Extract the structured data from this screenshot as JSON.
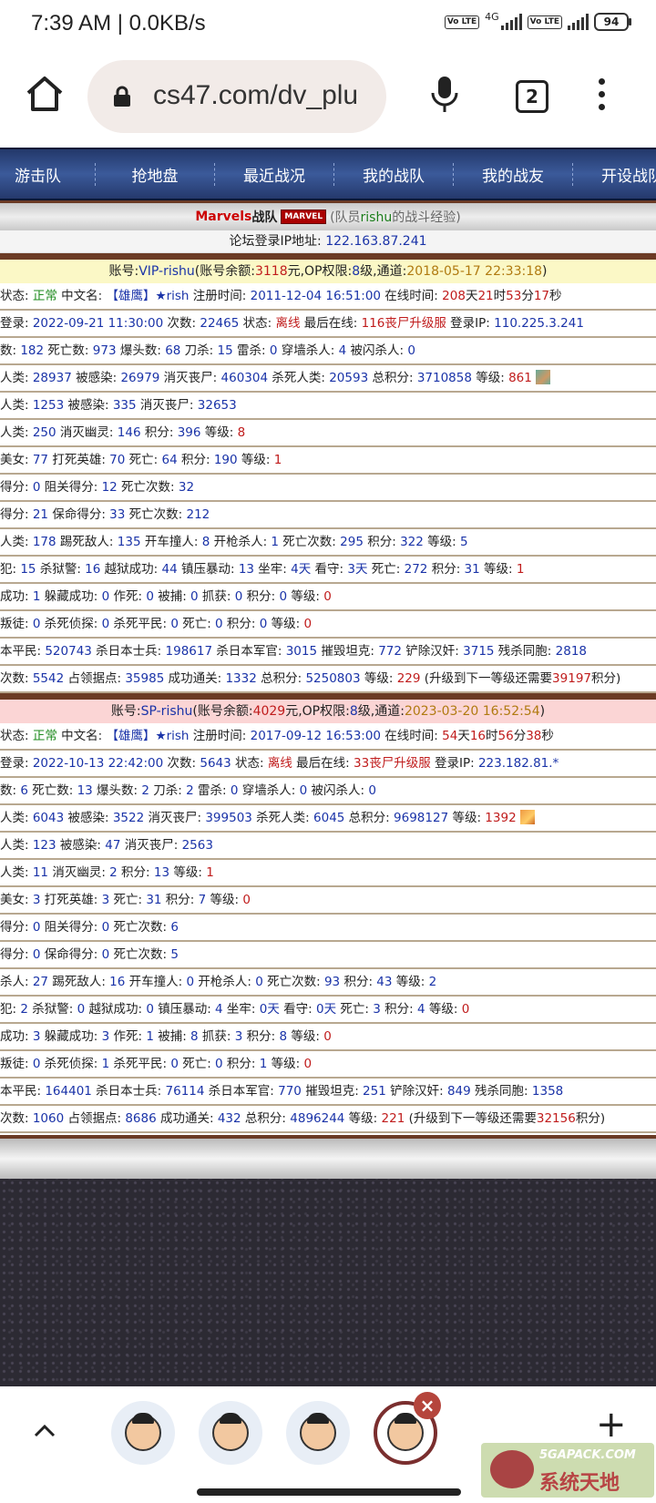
{
  "status_bar": {
    "time": "7:39 AM | 0.0KB/s",
    "network": "4G",
    "volte1": "Vo LTE",
    "volte2": "Vo LTE",
    "battery": "94"
  },
  "browser": {
    "url": "cs47.com/dv_plu",
    "tab_count": "2"
  },
  "nav": [
    "游击队",
    "抢地盘",
    "最近战况",
    "我的战队",
    "我的战友",
    "开设战队"
  ],
  "header": {
    "team_name": "Marvels",
    "team_suffix": "战队",
    "logo_text": "MARVEL",
    "sub_prefix": "(队员",
    "sub_user": "rishu",
    "sub_suffix": "的战斗经验)"
  },
  "ip_line": {
    "label": "论坛登录IP地址:",
    "ip": "122.163.87.241"
  },
  "accounts": [
    {
      "header": {
        "label": "账号:",
        "name": "VIP-rishu",
        "balance_label": "(账号余额:",
        "balance": "3118",
        "op_label": "元,OP权限:",
        "op": "8",
        "channel_label": "级,通道:",
        "channel": "2018-05-17 22:33:18",
        "end": ")"
      },
      "rows": [
        [
          "状态: ",
          {
            "t": "正常",
            "c": "g"
          },
          " 中文名: ",
          {
            "t": "【雄鹰】★rish",
            "c": "v"
          },
          " 注册时间: ",
          {
            "t": "2011-12-04 16:51:00",
            "c": "v"
          },
          " 在线时间: ",
          {
            "t": "208",
            "c": "r"
          },
          "天",
          {
            "t": "21",
            "c": "r"
          },
          "时",
          {
            "t": "53",
            "c": "r"
          },
          "分",
          {
            "t": "17",
            "c": "r"
          },
          "秒"
        ],
        [
          "登录: ",
          {
            "t": "2022-09-21 11:30:00",
            "c": "v"
          },
          " 次数: ",
          {
            "t": "22465",
            "c": "v"
          },
          " 状态: ",
          {
            "t": "离线",
            "c": "r"
          },
          " 最后在线: ",
          {
            "t": "116丧尸升级服",
            "c": "r"
          },
          " 登录IP: ",
          {
            "t": "110.225.3.241",
            "c": "v"
          }
        ],
        [
          "数: ",
          {
            "t": "182",
            "c": "v"
          },
          " 死亡数: ",
          {
            "t": "973",
            "c": "v"
          },
          " 爆头数: ",
          {
            "t": "68",
            "c": "v"
          },
          " 刀杀: ",
          {
            "t": "15",
            "c": "v"
          },
          " 雷杀: ",
          {
            "t": "0",
            "c": "v"
          },
          " 穿墙杀人: ",
          {
            "t": "4",
            "c": "v"
          },
          " 被闪杀人: ",
          {
            "t": "0",
            "c": "v"
          }
        ],
        [
          "人类: ",
          {
            "t": "28937",
            "c": "v"
          },
          " 被感染: ",
          {
            "t": "26979",
            "c": "v"
          },
          " 消灭丧尸: ",
          {
            "t": "460304",
            "c": "v"
          },
          " 杀死人类: ",
          {
            "t": "20593",
            "c": "v"
          },
          " 总积分: ",
          {
            "t": "3710858",
            "c": "v"
          },
          " 等级: ",
          {
            "t": "861",
            "c": "r"
          },
          {
            "avatar": "a"
          }
        ],
        [
          "人类: ",
          {
            "t": "1253",
            "c": "v"
          },
          " 被感染: ",
          {
            "t": "335",
            "c": "v"
          },
          " 消灭丧尸: ",
          {
            "t": "32653",
            "c": "v"
          }
        ],
        [
          "人类: ",
          {
            "t": "250",
            "c": "v"
          },
          " 消灭幽灵: ",
          {
            "t": "146",
            "c": "v"
          },
          " 积分: ",
          {
            "t": "396",
            "c": "v"
          },
          " 等级: ",
          {
            "t": "8",
            "c": "r"
          }
        ],
        [
          "美女: ",
          {
            "t": "77",
            "c": "v"
          },
          " 打死英雄: ",
          {
            "t": "70",
            "c": "v"
          },
          " 死亡: ",
          {
            "t": "64",
            "c": "v"
          },
          " 积分: ",
          {
            "t": "190",
            "c": "v"
          },
          " 等级: ",
          {
            "t": "1",
            "c": "r"
          }
        ],
        [
          "得分: ",
          {
            "t": "0",
            "c": "v"
          },
          " 阻关得分: ",
          {
            "t": "12",
            "c": "v"
          },
          " 死亡次数: ",
          {
            "t": "32",
            "c": "v"
          }
        ],
        [
          "得分: ",
          {
            "t": "21",
            "c": "v"
          },
          " 保命得分: ",
          {
            "t": "33",
            "c": "v"
          },
          " 死亡次数: ",
          {
            "t": "212",
            "c": "v"
          }
        ],
        [
          "人类: ",
          {
            "t": "178",
            "c": "v"
          },
          " 踢死敌人: ",
          {
            "t": "135",
            "c": "v"
          },
          " 开车撞人: ",
          {
            "t": "8",
            "c": "v"
          },
          " 开枪杀人: ",
          {
            "t": "1",
            "c": "v"
          },
          " 死亡次数: ",
          {
            "t": "295",
            "c": "v"
          },
          " 积分: ",
          {
            "t": "322",
            "c": "v"
          },
          " 等级: ",
          {
            "t": "5",
            "c": "v"
          }
        ],
        [
          "犯: ",
          {
            "t": "15",
            "c": "v"
          },
          " 杀狱警: ",
          {
            "t": "16",
            "c": "v"
          },
          " 越狱成功: ",
          {
            "t": "44",
            "c": "v"
          },
          " 镇压暴动: ",
          {
            "t": "13",
            "c": "v"
          },
          " 坐牢: ",
          {
            "t": "4天",
            "c": "v"
          },
          " 看守: ",
          {
            "t": "3天",
            "c": "v"
          },
          " 死亡: ",
          {
            "t": "272",
            "c": "v"
          },
          " 积分: ",
          {
            "t": "31",
            "c": "v"
          },
          " 等级: ",
          {
            "t": "1",
            "c": "r"
          }
        ],
        [
          "成功: ",
          {
            "t": "1",
            "c": "v"
          },
          " 躲藏成功: ",
          {
            "t": "0",
            "c": "v"
          },
          " 作死: ",
          {
            "t": "0",
            "c": "v"
          },
          " 被捕: ",
          {
            "t": "0",
            "c": "v"
          },
          " 抓获: ",
          {
            "t": "0",
            "c": "v"
          },
          " 积分: ",
          {
            "t": "0",
            "c": "v"
          },
          " 等级: ",
          {
            "t": "0",
            "c": "r"
          }
        ],
        [
          "叛徒: ",
          {
            "t": "0",
            "c": "v"
          },
          " 杀死侦探: ",
          {
            "t": "0",
            "c": "v"
          },
          " 杀死平民: ",
          {
            "t": "0",
            "c": "v"
          },
          " 死亡: ",
          {
            "t": "0",
            "c": "v"
          },
          " 积分: ",
          {
            "t": "0",
            "c": "v"
          },
          " 等级: ",
          {
            "t": "0",
            "c": "r"
          }
        ],
        [
          "本平民: ",
          {
            "t": "520743",
            "c": "v"
          },
          " 杀日本士兵: ",
          {
            "t": "198617",
            "c": "v"
          },
          " 杀日本军官: ",
          {
            "t": "3015",
            "c": "v"
          },
          " 摧毁坦克: ",
          {
            "t": "772",
            "c": "v"
          },
          " 铲除汉奸: ",
          {
            "t": "3715",
            "c": "v"
          },
          " 残杀同胞: ",
          {
            "t": "2818",
            "c": "v"
          }
        ],
        [
          "次数: ",
          {
            "t": "5542",
            "c": "v"
          },
          " 占领据点: ",
          {
            "t": "35985",
            "c": "v"
          },
          " 成功通关: ",
          {
            "t": "1332",
            "c": "v"
          },
          " 总积分: ",
          {
            "t": "5250803",
            "c": "v"
          },
          " 等级: ",
          {
            "t": "229",
            "c": "r"
          },
          " (升级到下一等级还需要",
          {
            "t": "39197",
            "c": "r"
          },
          "积分)"
        ]
      ]
    },
    {
      "header": {
        "label": "账号:",
        "name": "SP-rishu",
        "balance_label": "(账号余额:",
        "balance": "4029",
        "op_label": "元,OP权限:",
        "op": "8",
        "channel_label": "级,通道:",
        "channel": "2023-03-20 16:52:54",
        "end": ")"
      },
      "rows": [
        [
          "状态: ",
          {
            "t": "正常",
            "c": "g"
          },
          " 中文名: ",
          {
            "t": "【雄鹰】★rish",
            "c": "v"
          },
          " 注册时间: ",
          {
            "t": "2017-09-12 16:53:00",
            "c": "v"
          },
          " 在线时间: ",
          {
            "t": "54",
            "c": "r"
          },
          "天",
          {
            "t": "16",
            "c": "r"
          },
          "时",
          {
            "t": "56",
            "c": "r"
          },
          "分",
          {
            "t": "38",
            "c": "r"
          },
          "秒"
        ],
        [
          "登录: ",
          {
            "t": "2022-10-13 22:42:00",
            "c": "v"
          },
          " 次数: ",
          {
            "t": "5643",
            "c": "v"
          },
          " 状态: ",
          {
            "t": "离线",
            "c": "r"
          },
          " 最后在线: ",
          {
            "t": "33丧尸升级服",
            "c": "r"
          },
          " 登录IP: ",
          {
            "t": "223.182.81.*",
            "c": "v"
          }
        ],
        [
          "数: ",
          {
            "t": "6",
            "c": "v"
          },
          " 死亡数: ",
          {
            "t": "13",
            "c": "v"
          },
          " 爆头数: ",
          {
            "t": "2",
            "c": "v"
          },
          " 刀杀: ",
          {
            "t": "2",
            "c": "v"
          },
          " 雷杀: ",
          {
            "t": "0",
            "c": "v"
          },
          " 穿墙杀人: ",
          {
            "t": "0",
            "c": "v"
          },
          " 被闪杀人: ",
          {
            "t": "0",
            "c": "v"
          }
        ],
        [
          "人类: ",
          {
            "t": "6043",
            "c": "v"
          },
          " 被感染: ",
          {
            "t": "3522",
            "c": "v"
          },
          " 消灭丧尸: ",
          {
            "t": "399503",
            "c": "v"
          },
          " 杀死人类: ",
          {
            "t": "6045",
            "c": "v"
          },
          " 总积分: ",
          {
            "t": "9698127",
            "c": "v"
          },
          " 等级: ",
          {
            "t": "1392",
            "c": "r"
          },
          {
            "avatar": "b"
          }
        ],
        [
          "人类: ",
          {
            "t": "123",
            "c": "v"
          },
          " 被感染: ",
          {
            "t": "47",
            "c": "v"
          },
          " 消灭丧尸: ",
          {
            "t": "2563",
            "c": "v"
          }
        ],
        [
          "人类: ",
          {
            "t": "11",
            "c": "v"
          },
          " 消灭幽灵: ",
          {
            "t": "2",
            "c": "v"
          },
          " 积分: ",
          {
            "t": "13",
            "c": "v"
          },
          " 等级: ",
          {
            "t": "1",
            "c": "r"
          }
        ],
        [
          "美女: ",
          {
            "t": "3",
            "c": "v"
          },
          " 打死英雄: ",
          {
            "t": "3",
            "c": "v"
          },
          " 死亡: ",
          {
            "t": "31",
            "c": "v"
          },
          " 积分: ",
          {
            "t": "7",
            "c": "v"
          },
          " 等级: ",
          {
            "t": "0",
            "c": "r"
          }
        ],
        [
          "得分: ",
          {
            "t": "0",
            "c": "v"
          },
          " 阻关得分: ",
          {
            "t": "0",
            "c": "v"
          },
          " 死亡次数: ",
          {
            "t": "6",
            "c": "v"
          }
        ],
        [
          "得分: ",
          {
            "t": "0",
            "c": "v"
          },
          " 保命得分: ",
          {
            "t": "0",
            "c": "v"
          },
          " 死亡次数: ",
          {
            "t": "5",
            "c": "v"
          }
        ],
        [
          "杀人: ",
          {
            "t": "27",
            "c": "v"
          },
          " 踢死敌人: ",
          {
            "t": "16",
            "c": "v"
          },
          " 开车撞人: ",
          {
            "t": "0",
            "c": "v"
          },
          " 开枪杀人: ",
          {
            "t": "0",
            "c": "v"
          },
          " 死亡次数: ",
          {
            "t": "93",
            "c": "v"
          },
          " 积分: ",
          {
            "t": "43",
            "c": "v"
          },
          " 等级: ",
          {
            "t": "2",
            "c": "v"
          }
        ],
        [
          "犯: ",
          {
            "t": "2",
            "c": "v"
          },
          " 杀狱警: ",
          {
            "t": "0",
            "c": "v"
          },
          " 越狱成功: ",
          {
            "t": "0",
            "c": "v"
          },
          " 镇压暴动: ",
          {
            "t": "4",
            "c": "v"
          },
          " 坐牢: ",
          {
            "t": "0天",
            "c": "v"
          },
          " 看守: ",
          {
            "t": "0天",
            "c": "v"
          },
          " 死亡: ",
          {
            "t": "3",
            "c": "v"
          },
          " 积分: ",
          {
            "t": "4",
            "c": "v"
          },
          " 等级: ",
          {
            "t": "0",
            "c": "r"
          }
        ],
        [
          "成功: ",
          {
            "t": "3",
            "c": "v"
          },
          " 躲藏成功: ",
          {
            "t": "3",
            "c": "v"
          },
          " 作死: ",
          {
            "t": "1",
            "c": "v"
          },
          " 被捕: ",
          {
            "t": "8",
            "c": "v"
          },
          " 抓获: ",
          {
            "t": "3",
            "c": "v"
          },
          " 积分: ",
          {
            "t": "8",
            "c": "v"
          },
          " 等级: ",
          {
            "t": "0",
            "c": "r"
          }
        ],
        [
          "叛徒: ",
          {
            "t": "0",
            "c": "v"
          },
          " 杀死侦探: ",
          {
            "t": "1",
            "c": "v"
          },
          " 杀死平民: ",
          {
            "t": "0",
            "c": "v"
          },
          " 死亡: ",
          {
            "t": "0",
            "c": "v"
          },
          " 积分: ",
          {
            "t": "1",
            "c": "v"
          },
          " 等级: ",
          {
            "t": "0",
            "c": "r"
          }
        ],
        [
          "本平民: ",
          {
            "t": "164401",
            "c": "v"
          },
          " 杀日本士兵: ",
          {
            "t": "76114",
            "c": "v"
          },
          " 杀日本军官: ",
          {
            "t": "770",
            "c": "v"
          },
          " 摧毁坦克: ",
          {
            "t": "251",
            "c": "v"
          },
          " 铲除汉奸: ",
          {
            "t": "849",
            "c": "v"
          },
          " 残杀同胞: ",
          {
            "t": "1358",
            "c": "v"
          }
        ],
        [
          "次数: ",
          {
            "t": "1060",
            "c": "v"
          },
          " 占领据点: ",
          {
            "t": "8686",
            "c": "v"
          },
          " 成功通关: ",
          {
            "t": "432",
            "c": "v"
          },
          " 总积分: ",
          {
            "t": "4896244",
            "c": "v"
          },
          " 等级: ",
          {
            "t": "221",
            "c": "r"
          },
          " (升级到下一等级还需要",
          {
            "t": "32156",
            "c": "r"
          },
          "积分)"
        ]
      ]
    }
  ],
  "watermark": {
    "site": "5GAPACK.COM",
    "name": "系统天地"
  },
  "bottom": {
    "close": "×",
    "plus": "+"
  }
}
